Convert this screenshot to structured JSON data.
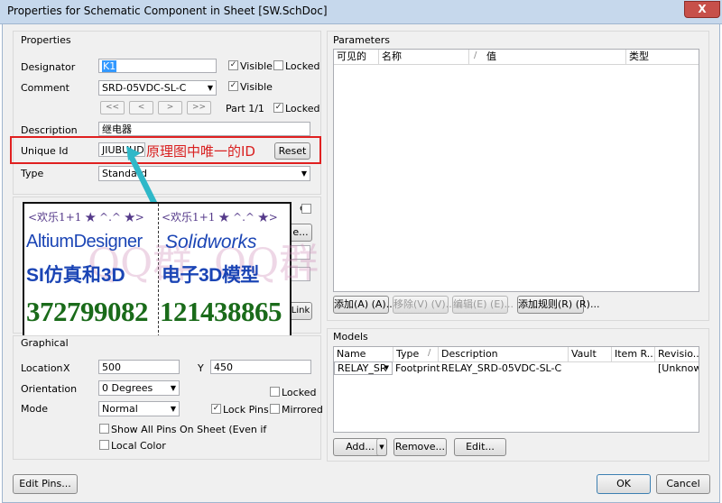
{
  "window": {
    "title": "Properties for Schematic Component in Sheet [SW.SchDoc]",
    "close": "X"
  },
  "properties": {
    "group_title": "Properties",
    "designator_label": "Designator",
    "designator_value": "K1",
    "comment_label": "Comment",
    "comment_value": "SRD-05VDC-SL-C",
    "visible_label": "Visible",
    "locked_label": "Locked",
    "nav": [
      "<<",
      "<",
      ">",
      ">>"
    ],
    "part_label": "Part 1/1",
    "description_label": "Description",
    "description_value": "继电器",
    "unique_id_label": "Unique Id",
    "unique_id_value": "JIUBUUDP",
    "reset_label": "Reset",
    "type_label": "Type",
    "type_value": "Standard",
    "annotation_text": "原理图中唯一的ID",
    "annotation_color": "#d92020",
    "highlight_color": "#e02020",
    "arrow_color": "#2fb8c8"
  },
  "overlay": {
    "left": {
      "tag": "<欢乐1+1 ★ ^.^ ★>",
      "line1": "AltiumDesigner",
      "line2": "SI仿真和3D",
      "number": "372799082",
      "watermark": "QQ群"
    },
    "right": {
      "tag": "<欢乐1+1 ★ ^.^ ★>",
      "line1": "Solidworks",
      "line2": "电子3D模型",
      "number": "121438865",
      "watermark": "QQ群"
    },
    "colors": {
      "blue": "#1b45b5",
      "green": "#1a6b1a",
      "tag": "#553a8a"
    }
  },
  "hidden_fragments": {
    "er": "er",
    "e": "e...",
    "link": "Link"
  },
  "graphical": {
    "group_title": "Graphical",
    "location_label": "Location",
    "x_label": "X",
    "x_value": "500",
    "y_label": "Y",
    "y_value": "450",
    "orientation_label": "Orientation",
    "orientation_value": "0 Degrees",
    "locked_label": "Locked",
    "mode_label": "Mode",
    "mode_value": "Normal",
    "lock_pins_label": "Lock Pins",
    "mirrored_label": "Mirrored",
    "show_all_pins_label": "Show All Pins On Sheet (Even if Hidde",
    "local_colors_label": "Local Color"
  },
  "parameters": {
    "group_title": "Parameters",
    "columns": [
      "可见的",
      "名称",
      "/",
      "值",
      "类型"
    ],
    "add_label": "添加(A) (A)...",
    "remove_label": "移除(V) (V)...",
    "edit_label": "编辑(E) (E)...",
    "add_rule_label": "添加规则(R) (R)..."
  },
  "models": {
    "group_title": "Models",
    "columns": [
      "Name",
      "Type",
      "/",
      "Description",
      "Vault",
      "Item R...",
      "Revisio..."
    ],
    "rows": [
      {
        "name": "RELAY_SR",
        "type": "Footprint",
        "description": "RELAY_SRD-05VDC-SL-C",
        "vault": "",
        "item": "",
        "revision": "[Unknowr"
      }
    ],
    "add_label": "Add...",
    "remove_label": "Remove...",
    "edit_label": "Edit..."
  },
  "footer": {
    "edit_pins_label": "Edit Pins...",
    "ok_label": "OK",
    "cancel_label": "Cancel"
  }
}
